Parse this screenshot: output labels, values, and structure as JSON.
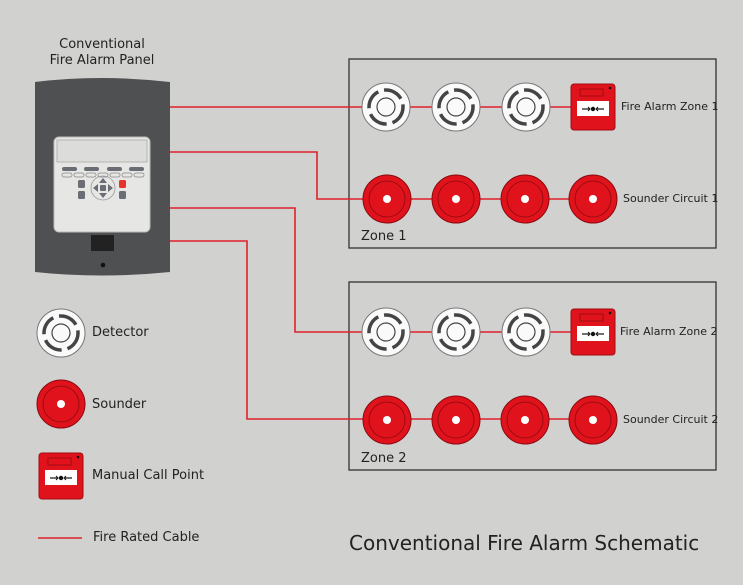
{
  "panel": {
    "title_line1": "Conventional",
    "title_line2": "Fire Alarm Panel"
  },
  "zones": [
    {
      "label": "Zone 1",
      "detector_circuit": "Fire Alarm Zone 1",
      "sounder_circuit": "Sounder Circuit 1",
      "detectors": 3,
      "sounders": 4,
      "call_points": 1
    },
    {
      "label": "Zone 2",
      "detector_circuit": "Fire Alarm Zone 2",
      "sounder_circuit": "Sounder Circuit 2",
      "detectors": 3,
      "sounders": 4,
      "call_points": 1
    }
  ],
  "legend": [
    {
      "icon": "detector-icon",
      "label": "Detector"
    },
    {
      "icon": "sounder-icon",
      "label": "Sounder"
    },
    {
      "icon": "manual-call-point-icon",
      "label": "Manual Call Point"
    },
    {
      "icon": "cable-icon",
      "label": "Fire Rated Cable"
    }
  ],
  "footer_title": "Conventional Fire Alarm Schematic",
  "colors": {
    "background": "#d1d1d0",
    "cable": "#e0202a",
    "device_red": "#e0121c",
    "panel": "#4f5052"
  }
}
